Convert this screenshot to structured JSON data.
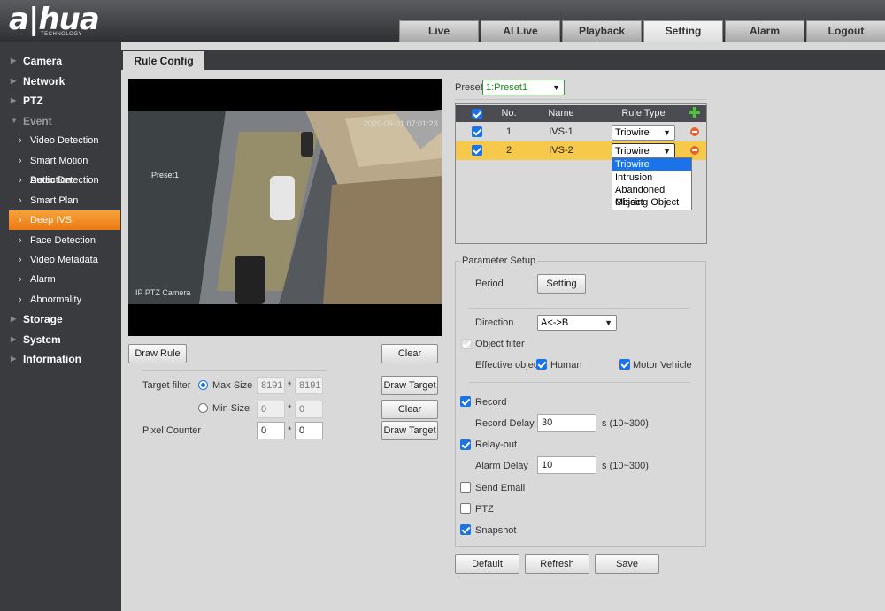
{
  "brand": {
    "logo": "a|hua",
    "sub": "TECHNOLOGY"
  },
  "topnav": [
    "Live",
    "AI Live",
    "Playback",
    "Setting",
    "Alarm",
    "Logout"
  ],
  "sidebar": {
    "main": [
      "Camera",
      "Network",
      "PTZ",
      "Event",
      "Storage",
      "System",
      "Information"
    ],
    "event_items": [
      "Video Detection",
      "Smart Motion Detection",
      "Audio Detection",
      "Smart Plan",
      "Deep IVS",
      "Face Detection",
      "Video Metadata",
      "Alarm",
      "Abnormality"
    ]
  },
  "tab": "Rule Config",
  "video": {
    "timestamp": "2020-09-01 07:01:23",
    "preset_label": "Preset1",
    "camera_label": "IP PTZ Camera"
  },
  "left_controls": {
    "draw_rule": "Draw Rule",
    "clear": "Clear",
    "target_filter": "Target filter",
    "max_size": "Max Size",
    "min_size": "Min Size",
    "max_w": "8191",
    "max_h": "8191",
    "min_w": "0",
    "min_h": "0",
    "pixel_counter": "Pixel Counter",
    "pc_w": "0",
    "pc_h": "0",
    "times": "*",
    "draw_target": "Draw Target",
    "clear2": "Clear"
  },
  "preset": {
    "label": "Preset",
    "value": "1:Preset1"
  },
  "rule_table": {
    "headers": [
      "No.",
      "Name",
      "Rule Type"
    ],
    "rows": [
      {
        "no": "1",
        "name": "IVS-1",
        "type": "Tripwire"
      },
      {
        "no": "2",
        "name": "IVS-2",
        "type": "Tripwire"
      }
    ],
    "dropdown_options": [
      "Tripwire",
      "Intrusion",
      "Abandoned Object",
      "Missing Object"
    ]
  },
  "param": {
    "legend": "Parameter Setup",
    "period": "Period",
    "setting": "Setting",
    "direction": "Direction",
    "direction_value": "A<->B",
    "object_filter": "Object filter",
    "effective_object": "Effective object",
    "human": "Human",
    "motor_vehicle": "Motor Vehicle",
    "record": "Record",
    "record_delay": "Record Delay",
    "record_delay_value": "30",
    "range": "s (10~300)",
    "relay_out": "Relay-out",
    "alarm_delay": "Alarm Delay",
    "alarm_delay_value": "10",
    "send_email": "Send Email",
    "ptz": "PTZ",
    "snapshot": "Snapshot"
  },
  "footer": {
    "default": "Default",
    "refresh": "Refresh",
    "save": "Save"
  }
}
